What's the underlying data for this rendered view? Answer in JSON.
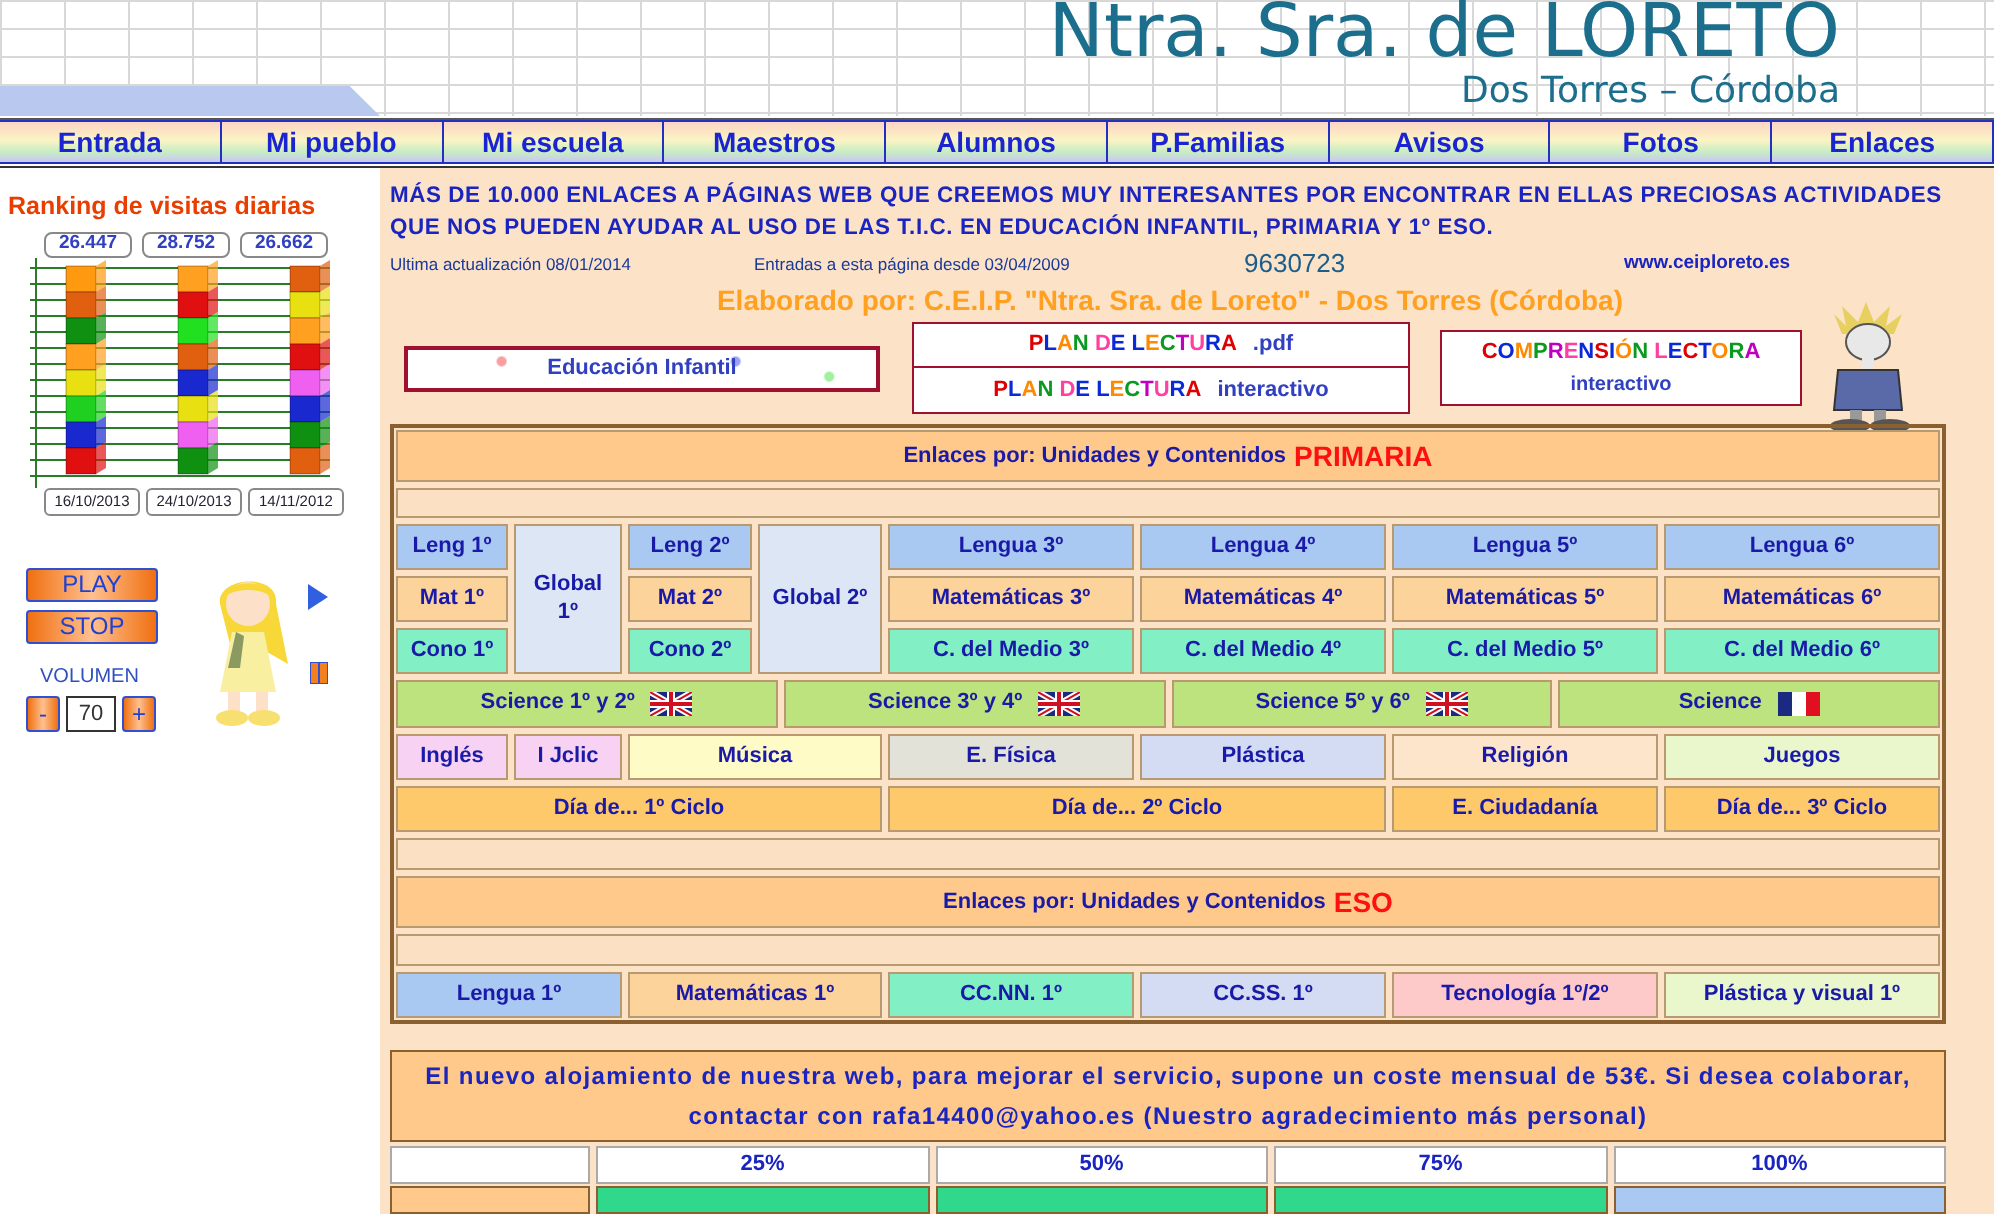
{
  "header": {
    "title": "Ntra. Sra. de LORETO",
    "subtitle": "Dos Torres – Córdoba"
  },
  "nav": [
    {
      "label": "Entrada"
    },
    {
      "label": "Mi pueblo"
    },
    {
      "label": "Mi escuela"
    },
    {
      "label": "Maestros"
    },
    {
      "label": "Alumnos"
    },
    {
      "label": "P.Familias"
    },
    {
      "label": "Avisos"
    },
    {
      "label": "Fotos"
    },
    {
      "label": "Enlaces"
    }
  ],
  "sidebar": {
    "ranking_title": "Ranking de visitas diarias",
    "visits": [
      {
        "count": "26.447",
        "date": "16/10/2013"
      },
      {
        "count": "28.752",
        "date": "24/10/2013"
      },
      {
        "count": "26.662",
        "date": "14/11/2012"
      }
    ],
    "player": {
      "play": "PLAY",
      "stop": "STOP",
      "volume_label": "VOLUMEN",
      "minus": "-",
      "volume": "70",
      "plus": "+"
    }
  },
  "intro": "MÁS DE 10.000 ENLACES A PÁGINAS WEB QUE CREEMOS MUY INTERESANTES POR ENCONTRAR EN ELLAS PRECIOSAS ACTIVIDADES QUE NOS PUEDEN AYUDAR AL USO DE LAS T.I.C. EN EDUCACIÓN INFANTIL, PRIMARIA Y 1º ESO.",
  "info": {
    "updated": "Ultima actualización 08/01/2014",
    "since": "Entradas a esta página desde 03/04/2009",
    "counter": "9630723",
    "website": "www.ceiploreto.es"
  },
  "credit": "Elaborado por: C.E.I.P. \"Ntra. Sra. de Loreto\" - Dos Torres (Córdoba)",
  "featured": {
    "infantil": "Educación Infantil",
    "plan_pdf": {
      "title": "PLAN DE LECTURA",
      "suffix": ".pdf"
    },
    "plan_interactive": {
      "title": "PLAN DE LECTURA",
      "suffix": "interactivo"
    },
    "comprension": {
      "title": "COMPRENSIÓN LECTORA",
      "suffix": "interactivo"
    }
  },
  "primaria": {
    "heading": "Enlaces por: Unidades y Contenidos",
    "stage": "PRIMARIA",
    "blocks": [
      {
        "kind": "columns",
        "columns": [
          [
            {
              "label": "Leng 1º",
              "color": "#a9c9f2"
            },
            {
              "label": "Mat 1º",
              "color": "#fdd39c"
            },
            {
              "label": "Cono 1º",
              "color": "#82f0c4"
            }
          ],
          [
            {
              "label": "Global 1º",
              "color": "#dde6f5"
            }
          ],
          [
            {
              "label": "Leng 2º",
              "color": "#a9c9f2"
            },
            {
              "label": "Mat 2º",
              "color": "#fdd39c"
            },
            {
              "label": "Cono 2º",
              "color": "#82f0c4"
            }
          ],
          [
            {
              "label": "Global 2º",
              "color": "#dde6f5"
            }
          ],
          [
            {
              "label": "Lengua 3º",
              "color": "#a9c9f2"
            },
            {
              "label": "Matemáticas 3º",
              "color": "#fdd39c"
            },
            {
              "label": "C. del Medio 3º",
              "color": "#82f0c4"
            }
          ],
          [
            {
              "label": "Lengua 4º",
              "color": "#a9c9f2"
            },
            {
              "label": "Matemáticas 4º",
              "color": "#fdd39c"
            },
            {
              "label": "C. del Medio 4º",
              "color": "#82f0c4"
            }
          ],
          [
            {
              "label": "Lengua 5º",
              "color": "#a9c9f2"
            },
            {
              "label": "Matemáticas 5º",
              "color": "#fdd39c"
            },
            {
              "label": "C. del Medio 5º",
              "color": "#82f0c4"
            }
          ],
          [
            {
              "label": "Lengua 6º",
              "color": "#a9c9f2"
            },
            {
              "label": "Matemáticas 6º",
              "color": "#fdd39c"
            },
            {
              "label": "C. del Medio 6º",
              "color": "#82f0c4"
            }
          ]
        ]
      },
      {
        "kind": "flags",
        "cells": [
          {
            "label": "Science 1º y 2º",
            "color": "#bde37e",
            "kind": "uk"
          },
          {
            "label": "Science 3º y 4º",
            "color": "#bde37e",
            "kind": "uk"
          },
          {
            "label": "Science 5º y 6º",
            "color": "#bde37e",
            "kind": "uk"
          },
          {
            "label": "Science",
            "color": "#bde37e",
            "kind": "fr"
          }
        ]
      },
      {
        "kind": "grid",
        "cells": [
          {
            "label": "Inglés",
            "color": "#f8d2f2"
          },
          {
            "label": "I Jclic",
            "color": "#f8d2f2"
          },
          {
            "label": "Música",
            "color": "#fffbc6",
            "kind": "double"
          },
          {
            "label": "E. Física",
            "color": "#e2e2d8"
          },
          {
            "label": "Plástica",
            "color": "#d4dcf4"
          },
          {
            "label": "Religión",
            "color": "#fde5cc"
          },
          {
            "label": "Juegos",
            "color": "#eaf6cc"
          },
          {
            "label": "Día de... 1º Ciclo",
            "color": "#fec96a",
            "kind": "quad"
          },
          {
            "label": "Día de... 2º Ciclo",
            "color": "#fec96a",
            "kind": "double"
          },
          {
            "label": "E. Ciudadanía",
            "color": "#fec96a"
          },
          {
            "label": "Día de... 3º Ciclo",
            "color": "#fec96a"
          }
        ]
      }
    ]
  },
  "eso": {
    "heading": "Enlaces por: Unidades y Contenidos",
    "stage": "ESO",
    "cells": [
      {
        "label": "Lengua 1º",
        "color": "#a9c9f2",
        "kind": "double"
      },
      {
        "label": "Matemáticas 1º",
        "color": "#fdd39c",
        "kind": "double"
      },
      {
        "label": "CC.NN. 1º",
        "color": "#82f0c4"
      },
      {
        "label": "CC.SS. 1º",
        "color": "#d4dcf4"
      },
      {
        "label": "Tecnología 1º/2º",
        "color": "#fdc9c9"
      },
      {
        "label": "Plástica y visual 1º",
        "color": "#eaf6cc"
      }
    ]
  },
  "donation": {
    "message": "El nuevo alojamiento de nuestra web, para mejorar el servicio, supone un coste mensual de 53€. Si desea colaborar, contactar con rafa14400@yahoo.es (Nuestro agradecimiento más personal)",
    "levels": [
      "25%",
      "50%",
      "75%",
      "100%"
    ],
    "next_row": [
      {
        "color": "#fec98a"
      },
      {
        "color": "#2fd88a"
      },
      {
        "color": "#2fd88a"
      },
      {
        "color": "#2fd88a"
      },
      {
        "color": "#a9c9f2"
      }
    ]
  }
}
